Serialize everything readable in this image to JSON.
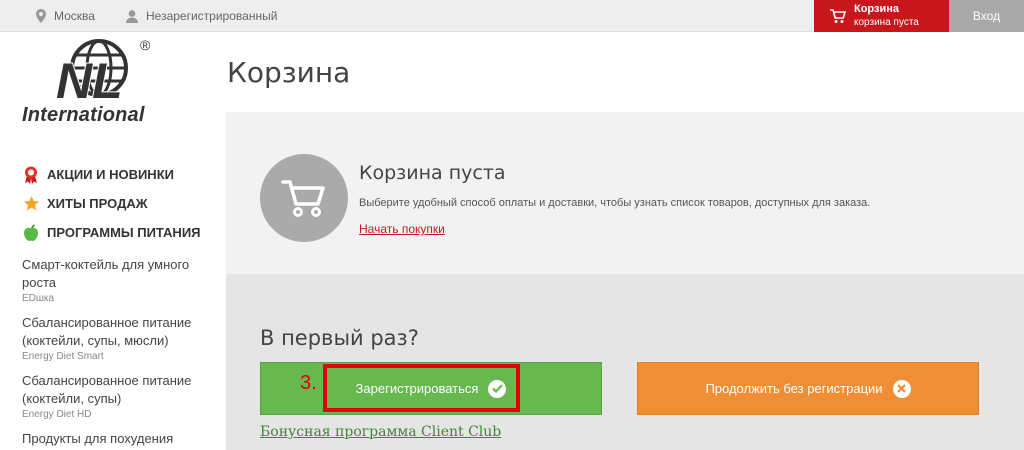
{
  "topbar": {
    "city": "Москва",
    "user_status": "Незарегистрированный",
    "cart_title": "Корзина",
    "cart_subtitle": "корзина пуста",
    "login": "Вход"
  },
  "logo": {
    "text": "International",
    "mark": "NL",
    "registered": "®"
  },
  "sidebar": {
    "categories": [
      {
        "label": "АКЦИИ И НОВИНКИ",
        "icon": "award-ribbon-icon",
        "color": "#e2332b"
      },
      {
        "label": "ХИТЫ ПРОДАЖ",
        "icon": "star-icon",
        "color": "#f5a623"
      },
      {
        "label": "ПРОГРАММЫ ПИТАНИЯ",
        "icon": "apple-icon",
        "color": "#58b947"
      }
    ],
    "products": [
      {
        "name": "Смарт-коктейль для умного роста",
        "brand": "EDшка"
      },
      {
        "name": "Сбалансированное питание (коктейли, супы, мюсли)",
        "brand": "Energy Diet Smart"
      },
      {
        "name": "Сбалансированное питание (коктейли, супы)",
        "brand": "Energy Diet HD"
      },
      {
        "name": "Продукты для похудения",
        "brand": ""
      }
    ]
  },
  "main": {
    "title": "Корзина",
    "empty": {
      "title": "Корзина пуста",
      "description": "Выберите удобный способ оплаты и доставки, чтобы узнать список товаров, доступных для заказа.",
      "link": "Начать покупки"
    },
    "first_time": {
      "title": "В первый раз?",
      "register_button": "Зарегистрироваться",
      "continue_button": "Продолжить без регистрации",
      "club_link": "Бонусная программа Client Club"
    },
    "annotation": {
      "step": "3."
    }
  },
  "colors": {
    "brand_red": "#c8161d",
    "green": "#66b84f",
    "orange": "#ef8e35",
    "highlight": "#e2000f"
  }
}
